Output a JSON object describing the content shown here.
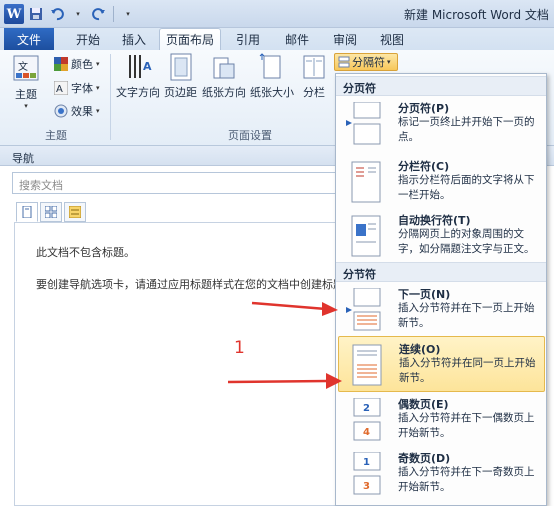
{
  "window": {
    "title": "新建 Microsoft Word 文档"
  },
  "quick_access": {
    "logo": "W",
    "icons": [
      "word-logo-icon",
      "save-icon",
      "undo-icon",
      "redo-icon",
      "customize-icon"
    ]
  },
  "tabs": [
    {
      "label": "文件"
    },
    {
      "label": "开始"
    },
    {
      "label": "插入"
    },
    {
      "label": "页面布局"
    },
    {
      "label": "引用"
    },
    {
      "label": "邮件"
    },
    {
      "label": "审阅"
    },
    {
      "label": "视图"
    }
  ],
  "ribbon": {
    "theme": {
      "main_label": "主题",
      "colors": "颜色",
      "fonts": "字体",
      "effects": "效果",
      "group_label": "主题"
    },
    "page_setup": {
      "buttons": [
        "文字方向",
        "页边距",
        "纸张方向",
        "纸张大小",
        "分栏"
      ],
      "group_label": "页面设置",
      "breaks_label": "分隔符"
    }
  },
  "nav": {
    "title": "导航",
    "search_placeholder": "搜索文档",
    "message1": "此文档不包含标题。",
    "message2": "要创建导航选项卡，请通过应用标题样式在您的文档中创建标题。"
  },
  "menu": {
    "section1": "分页符",
    "section2": "分节符",
    "items": [
      {
        "title": "分页符(P)",
        "desc": "标记一页终止并开始下一页的点。"
      },
      {
        "title": "分栏符(C)",
        "desc": "指示分栏符后面的文字将从下一栏开始。"
      },
      {
        "title": "自动换行符(T)",
        "desc": "分隔网页上的对象周围的文字，如分隔题注文字与正文。"
      },
      {
        "title": "下一页(N)",
        "desc": "插入分节符并在下一页上开始新节。"
      },
      {
        "title": "连续(O)",
        "desc": "插入分节符并在同一页上开始新节。"
      },
      {
        "title": "偶数页(E)",
        "desc": "插入分节符并在下一偶数页上开始新节。"
      },
      {
        "title": "奇数页(D)",
        "desc": "插入分节符并在下一奇数页上开始新节。"
      }
    ],
    "highlighted_item": "连续(O)"
  },
  "annotation": {
    "number": "1",
    "arrow_color": "#e0342d"
  }
}
